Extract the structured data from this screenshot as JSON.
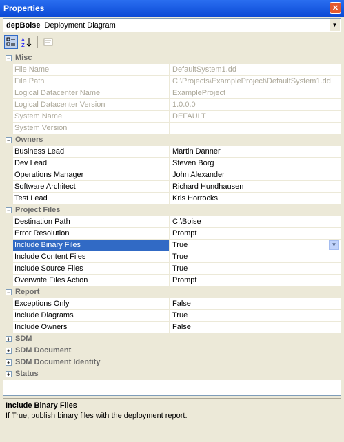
{
  "window": {
    "title": "Properties",
    "close_glyph": "✕"
  },
  "object_selector": {
    "name": "depBoise",
    "type": "Deployment Diagram"
  },
  "toolbar": {
    "icons": [
      "categorized-icon",
      "alphabetical-icon",
      "property-pages-icon"
    ]
  },
  "grid": {
    "categories": [
      {
        "label": "Misc",
        "expanded": true,
        "rows": [
          {
            "name": "File Name",
            "value": "DefaultSystem1.dd",
            "readonly": true
          },
          {
            "name": "File Path",
            "value": "C:\\Projects\\ExampleProject\\DefaultSystem1.dd",
            "readonly": true
          },
          {
            "name": "Logical Datacenter Name",
            "value": "ExampleProject",
            "readonly": true
          },
          {
            "name": "Logical Datacenter Version",
            "value": "1.0.0.0",
            "readonly": true
          },
          {
            "name": "System Name",
            "value": "DEFAULT",
            "readonly": true
          },
          {
            "name": "System Version",
            "value": "",
            "readonly": true
          }
        ]
      },
      {
        "label": "Owners",
        "expanded": true,
        "rows": [
          {
            "name": "Business Lead",
            "value": "Martin Danner"
          },
          {
            "name": "Dev Lead",
            "value": "Steven Borg"
          },
          {
            "name": "Operations Manager",
            "value": "John Alexander"
          },
          {
            "name": "Software Architect",
            "value": "Richard Hundhausen"
          },
          {
            "name": "Test Lead",
            "value": "Kris Horrocks"
          }
        ]
      },
      {
        "label": "Project Files",
        "expanded": true,
        "rows": [
          {
            "name": "Destination Path",
            "value": "C:\\Boise"
          },
          {
            "name": "Error Resolution",
            "value": "Prompt"
          },
          {
            "name": "Include Binary Files",
            "value": "True",
            "selected": true
          },
          {
            "name": "Include Content Files",
            "value": "True"
          },
          {
            "name": "Include Source Files",
            "value": "True"
          },
          {
            "name": "Overwrite Files Action",
            "value": "Prompt"
          }
        ]
      },
      {
        "label": "Report",
        "expanded": true,
        "rows": [
          {
            "name": "Exceptions Only",
            "value": "False"
          },
          {
            "name": "Include Diagrams",
            "value": "True"
          },
          {
            "name": "Include Owners",
            "value": "False"
          }
        ]
      },
      {
        "label": "SDM",
        "expanded": false,
        "rows": []
      },
      {
        "label": "SDM Document",
        "expanded": false,
        "rows": []
      },
      {
        "label": "SDM Document Identity",
        "expanded": false,
        "rows": []
      },
      {
        "label": "Status",
        "expanded": false,
        "rows": []
      }
    ]
  },
  "description": {
    "title": "Include Binary Files",
    "text": "If True, publish binary files with the deployment report."
  }
}
